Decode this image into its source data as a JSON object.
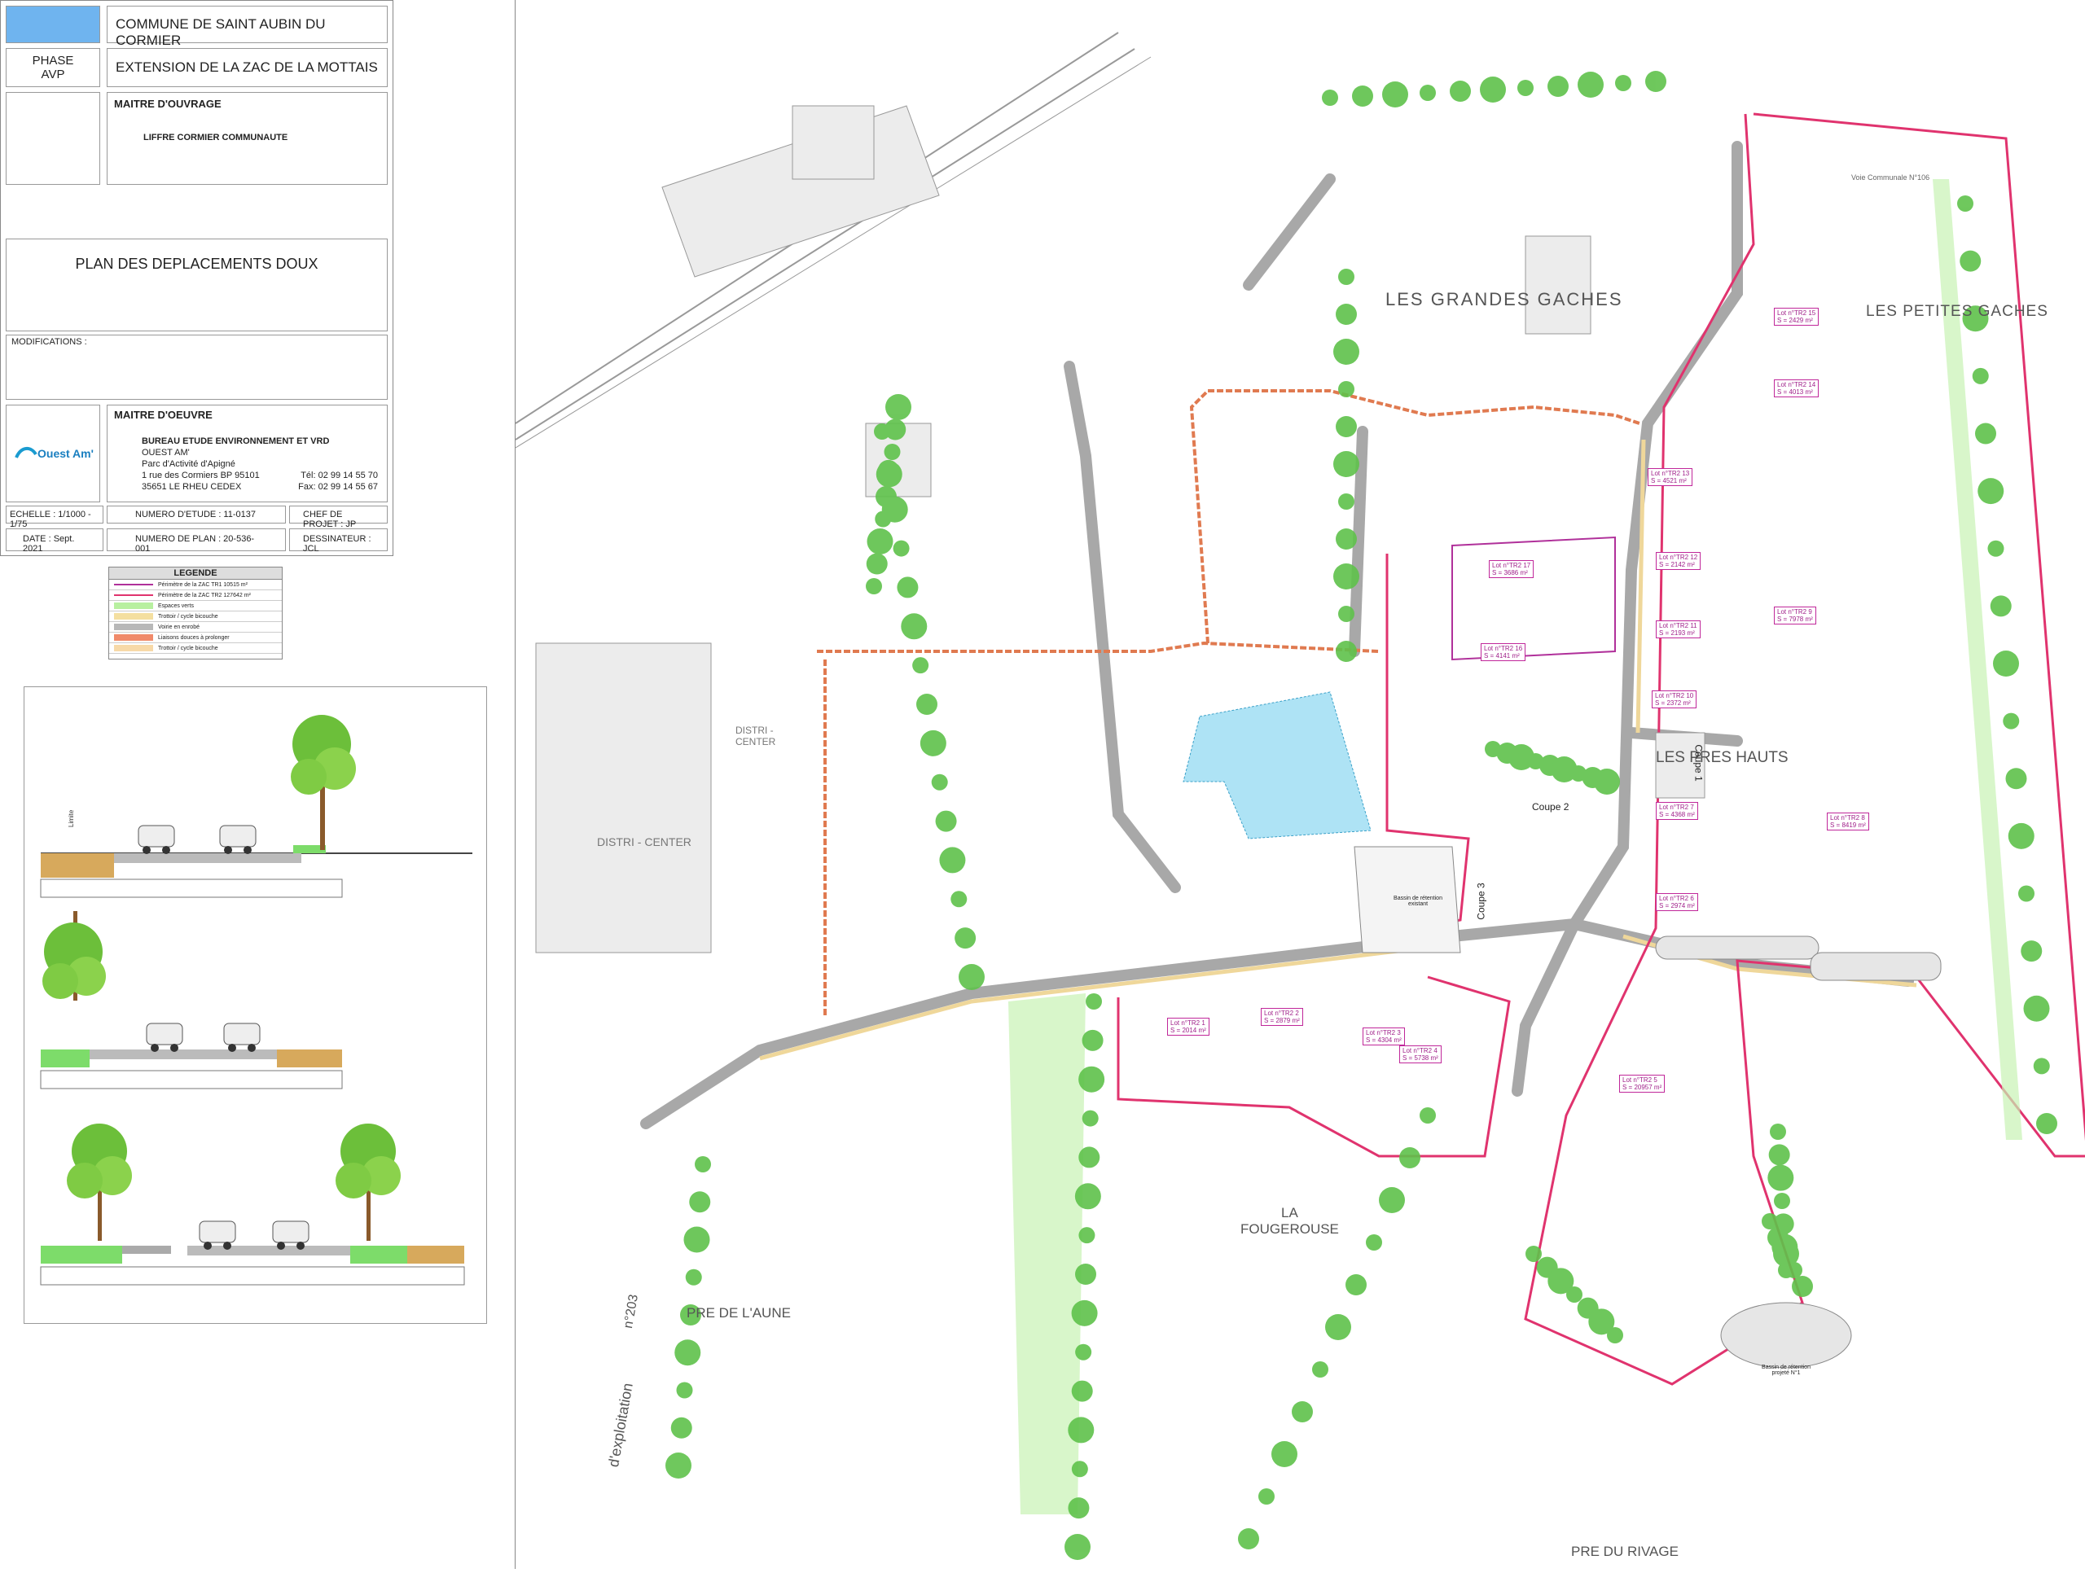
{
  "cartouche": {
    "commune": "COMMUNE DE SAINT AUBIN DU CORMIER",
    "phase_label": "PHASE",
    "phase_value": "AVP",
    "project": "EXTENSION DE LA ZAC DE LA MOTTAIS",
    "maitre_ouvrage_label": "MAITRE D'OUVRAGE",
    "maitre_ouvrage": "LIFFRE CORMIER COMMUNAUTE",
    "plan_title": "PLAN DES DEPLACEMENTS DOUX",
    "modifications_label": "MODIFICATIONS :",
    "maitre_oeuvre_label": "MAITRE D'OEUVRE",
    "logo_text": "Ouest Am'",
    "bureau": "BUREAU ETUDE ENVIRONNEMENT ET VRD",
    "company": "OUEST AM'",
    "parc": "Parc d'Activité d'Apigné",
    "address": "1 rue des Cormiers  BP 95101",
    "city": "35651 LE RHEU CEDEX",
    "tel": "Tél: 02 99 14 55 70",
    "fax": "Fax: 02 99 14 55 67",
    "echelle": "ECHELLE : 1/1000 - 1/75",
    "numero_etude": "NUMERO D'ETUDE : 11-0137",
    "chef_projet": "CHEF DE PROJET : JP",
    "date": "DATE : Sept. 2021",
    "numero_plan": "NUMERO DE PLAN : 20-536-001",
    "dessinateur": "DESSINATEUR : JCL"
  },
  "legend": {
    "title": "LEGENDE",
    "items": [
      {
        "label": "Périmètre de la ZAC TR1 10515 m²",
        "color": "#b0309a"
      },
      {
        "label": "Périmètre de la ZAC TR2 127642 m²",
        "color": "#e0336e"
      },
      {
        "label": "Espaces verts",
        "color": "#b8f0a0"
      },
      {
        "label": "Trottoir / cycle bicouche",
        "color": "#f4dfa0"
      },
      {
        "label": "Voirie en enrobé",
        "color": "#b8b8b8"
      },
      {
        "label": "Liaisons douces à prolonger",
        "color": "#f08a6a"
      },
      {
        "label": "Trottoir / cycle bicouche",
        "color": "#f7d9a8"
      }
    ]
  },
  "sections": {
    "coupe1": "COUPE 1",
    "coupe2": "COUPE 2",
    "coupe3": "COUPE 3"
  },
  "map_labels": {
    "les_grandes_gaches": "LES  GRANDES  GACHES",
    "les_petites_gaches": "LES  PETITES  GACHES",
    "les_pres_hauts": "LES PRES HAUTS",
    "distri_center": "DISTRI - CENTER",
    "distri_center2": "DISTRI -\nCENTER",
    "la_fougerouse": "LA\nFOUGEROUSE",
    "pre_de_laune": "PRE DE L'AUNE",
    "pre_du_rivage": "PRE DU RIVAGE",
    "dexploitation": "d'exploitation",
    "coupe1": "Coupe 1",
    "coupe2": "Coupe 2",
    "coupe3": "Coupe 3",
    "bassin_existant": "Bassin de rétention existant",
    "bassin_projete1": "Bassin de rétention projeté N°1",
    "n203": "n°203",
    "voie_communale": "Voie Communale N°106"
  },
  "lots": [
    {
      "label": "Lot n°TR2 15",
      "area": "S = 2429 m²"
    },
    {
      "label": "Lot n°TR2 14",
      "area": "S = 4013 m²"
    },
    {
      "label": "Lot n°TR2 13",
      "area": "S = 4521 m²"
    },
    {
      "label": "Lot n°TR2 12",
      "area": "S = 2142 m²"
    },
    {
      "label": "Lot n°TR2 11",
      "area": "S = 2193 m²"
    },
    {
      "label": "Lot n°TR2 10",
      "area": "S = 2372 m²"
    },
    {
      "label": "Lot n°TR2 9",
      "area": "S = 7978 m²"
    },
    {
      "label": "Lot n°TR2 8",
      "area": "S = 8419 m²"
    },
    {
      "label": "Lot n°TR2 7",
      "area": "S = 4368 m²"
    },
    {
      "label": "Lot n°TR2 6",
      "area": "S = 2974 m²"
    },
    {
      "label": "Lot n°TR2 5",
      "area": "S = 20957 m²"
    },
    {
      "label": "Lot n°TR2 4",
      "area": "S = 5738 m²"
    },
    {
      "label": "Lot n°TR2 3",
      "area": "S = 4304 m²"
    },
    {
      "label": "Lot n°TR2 2",
      "area": "S = 2879 m²"
    },
    {
      "label": "Lot n°TR2 1",
      "area": "S = 2014 m²"
    },
    {
      "label": "Lot n°TR2 17",
      "area": "S = 3686 m²"
    },
    {
      "label": "Lot n°TR2 16",
      "area": "S = 4141 m²"
    }
  ]
}
